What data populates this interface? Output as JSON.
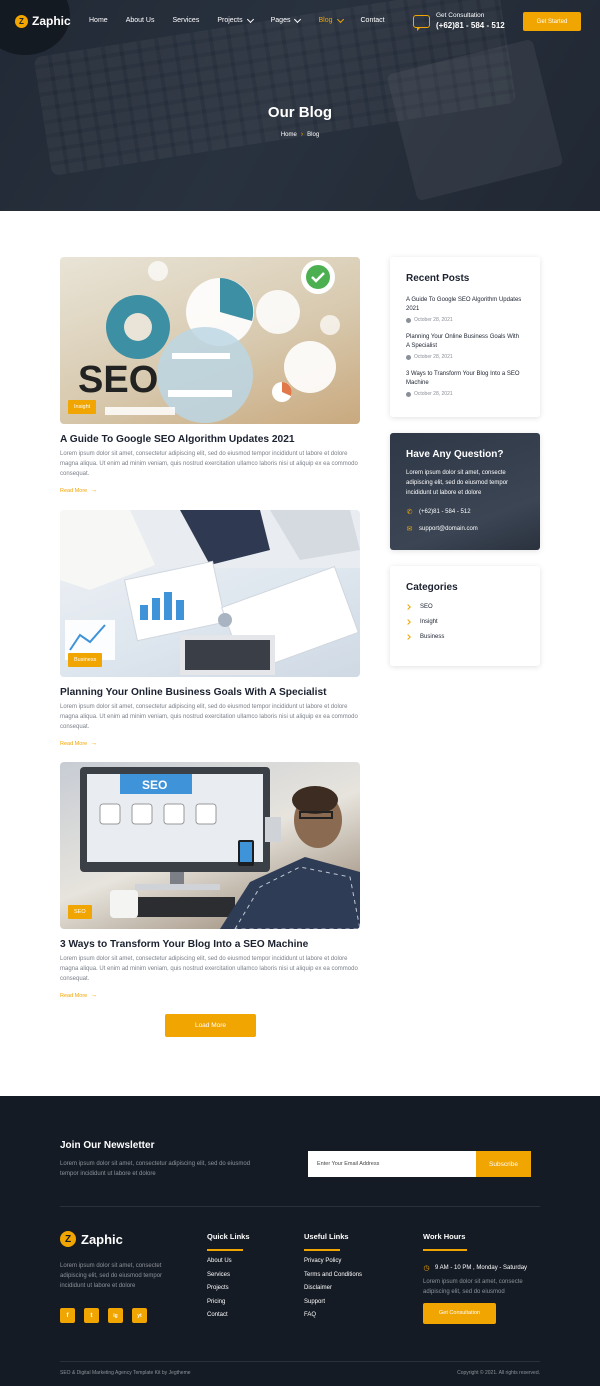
{
  "brand": {
    "name": "Zaphic",
    "accent": "#f0a500",
    "dark": "#151b24"
  },
  "nav": {
    "items": [
      {
        "label": "Home",
        "dropdown": false,
        "active": false
      },
      {
        "label": "About Us",
        "dropdown": false,
        "active": false
      },
      {
        "label": "Services",
        "dropdown": false,
        "active": false
      },
      {
        "label": "Projects",
        "dropdown": true,
        "active": false
      },
      {
        "label": "Pages",
        "dropdown": true,
        "active": false
      },
      {
        "label": "Blog",
        "dropdown": true,
        "active": true
      },
      {
        "label": "Contact",
        "dropdown": false,
        "active": false
      }
    ],
    "consult_label": "Get Consultation",
    "consult_phone": "(+62)81 - 584 - 512",
    "cta": "Get Started"
  },
  "hero": {
    "title": "Our Blog",
    "breadcrumb": [
      "Home",
      "Blog"
    ]
  },
  "posts": [
    {
      "tag": "Insight",
      "title": "A Guide To Google SEO Algorithm Updates 2021",
      "excerpt": "Lorem ipsum dolor sit amet, consectetur adipiscing elit, sed do eiusmod tempor incididunt ut labore et dolore magna aliqua. Ut enim ad minim veniam, quis nostrud exercitation ullamco laboris nisi ut aliquip ex ea commodo consequat.",
      "read_more": "Read More"
    },
    {
      "tag": "Business",
      "title": "Planning Your Online Business Goals With A Specialist",
      "excerpt": "Lorem ipsum dolor sit amet, consectetur adipiscing elit, sed do eiusmod tempor incididunt ut labore et dolore magna aliqua. Ut enim ad minim veniam, quis nostrud exercitation ullamco laboris nisi ut aliquip ex ea commodo consequat.",
      "read_more": "Read More"
    },
    {
      "tag": "SEO",
      "title": "3 Ways to Transform Your Blog Into a SEO Machine",
      "excerpt": "Lorem ipsum dolor sit amet, consectetur adipiscing elit, sed do eiusmod tempor incididunt ut labore et dolore magna aliqua. Ut enim ad minim veniam, quis nostrud exercitation ullamco laboris nisi ut aliquip ex ea commodo consequat.",
      "read_more": "Read More"
    }
  ],
  "load_more": "Load More",
  "sidebar": {
    "recent": {
      "title": "Recent Posts",
      "items": [
        {
          "title": "A Guide To Google SEO Algorithm Updates 2021",
          "date": "October 28, 2021"
        },
        {
          "title": "Planning Your Online Business Goals With A Specialist",
          "date": "October 28, 2021"
        },
        {
          "title": "3 Ways to Transform Your Blog Into a SEO Machine",
          "date": "October 28, 2021"
        }
      ]
    },
    "question": {
      "title": "Have Any Question?",
      "text": "Lorem ipsum dolor sit amet, consecte adipiscing elit, sed do eiusmod tempor incididunt ut labore et dolore",
      "phone": "(+62)81 - 584 - 512",
      "email": "support@domain.com"
    },
    "categories": {
      "title": "Categories",
      "items": [
        "SEO",
        "Insight",
        "Business"
      ]
    }
  },
  "footer": {
    "newsletter_title": "Join Our Newsletter",
    "newsletter_text": "Lorem ipsum dolor sit amet, consectetur adipiscing elit, sed do eiusmod tempor incididunt ut labore et dolore",
    "email_placeholder": "Enter Your Email Address",
    "subscribe": "Subscribe",
    "brand_desc": "Lorem ipsum dolor sit amet, consectet adipiscing elit, sed do eiusmod tempor incididunt ut labore et dolore",
    "social": [
      "f",
      "t",
      "ig",
      "yt"
    ],
    "quick_links": {
      "title": "Quick Links",
      "items": [
        "About Us",
        "Services",
        "Projects",
        "Pricing",
        "Contact"
      ]
    },
    "useful_links": {
      "title": "Useful Links",
      "items": [
        "Privacy Policy",
        "Terms and Conditions",
        "Disclaimer",
        "Support",
        "FAQ"
      ]
    },
    "work_hours": {
      "title": "Work Hours",
      "hours": "9 AM - 10 PM , Monday - Saturday",
      "text": "Lorem ipsum dolor sit amet, consecte adipiscing elit, sed do eiusmod",
      "cta": "Get Consultation"
    },
    "copyright_left": "SEO & Digital Marketing Agency Template Kit by Jegtheme",
    "copyright_right": "Copyright © 2021. All rights reserved."
  }
}
